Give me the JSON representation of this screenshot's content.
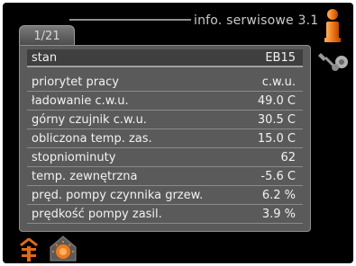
{
  "header": {
    "title": "info. serwisowe 3.1",
    "page_tab": "1/21"
  },
  "rows": [
    {
      "label": "stan",
      "value": "EB15"
    },
    {
      "label": "priorytet pracy",
      "value": "c.w.u."
    },
    {
      "label": "ładowanie c.w.u.",
      "value": "49.0  C"
    },
    {
      "label": "górny czujnik c.w.u.",
      "value": "30.5  C"
    },
    {
      "label": "obliczona temp. zas.",
      "value": "15.0  C"
    },
    {
      "label": "stopniominuty",
      "value": "62"
    },
    {
      "label": "temp. zewnętrzna",
      "value": "-5.6  C"
    },
    {
      "label": "pręd. pompy czynnika grzew.",
      "value": "6.2  %"
    },
    {
      "label": "prędkość pompy zasil.",
      "value": "3.9  %"
    }
  ],
  "icons": {
    "info": "info-icon",
    "service": "service-tools-icon",
    "hot_water": "hot-water-icon",
    "heating": "house-heating-icon"
  },
  "colors": {
    "accent": "#f07a1a",
    "panel": "#5a5a5a",
    "background": "#000000"
  }
}
